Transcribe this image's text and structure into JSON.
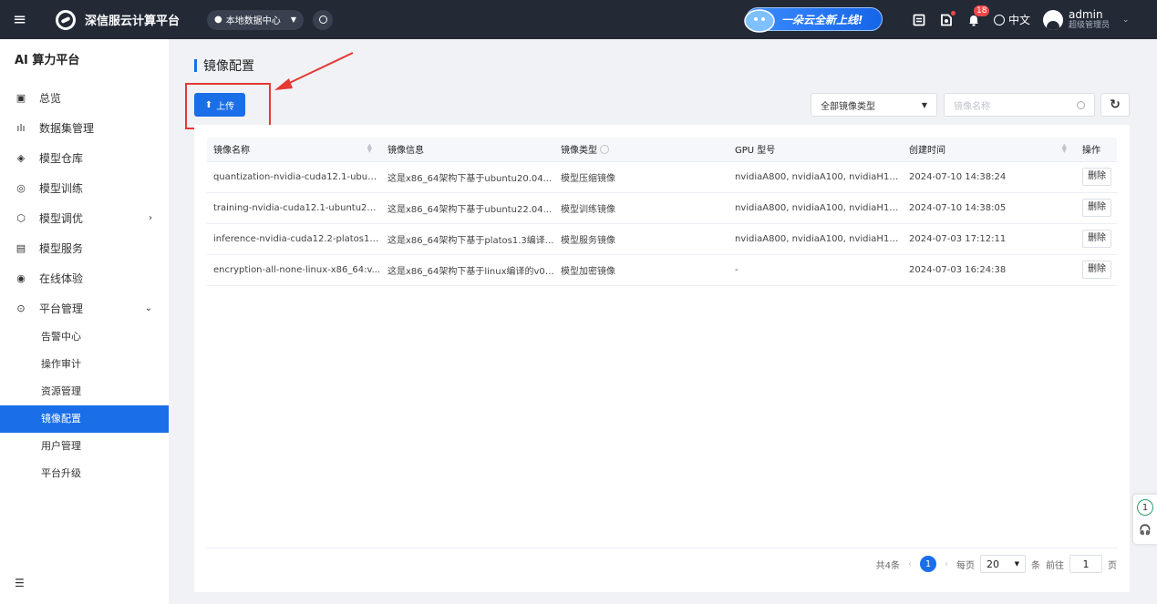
{
  "topbar": {
    "app_name": "深信服云计算平台",
    "datacenter": "本地数据中心",
    "promo_text": "一朵云全新上线!",
    "notification_count": "18",
    "language": "中文",
    "user_name": "admin",
    "user_role": "超级管理员"
  },
  "sidebar": {
    "title": "AI 算力平台",
    "items": [
      {
        "label": "总览",
        "icon": "monitor-icon"
      },
      {
        "label": "数据集管理",
        "icon": "bar-chart-icon"
      },
      {
        "label": "模型仓库",
        "icon": "model-repo-icon"
      },
      {
        "label": "模型训练",
        "icon": "training-icon"
      },
      {
        "label": "模型调优",
        "icon": "tuning-icon"
      },
      {
        "label": "模型服务",
        "icon": "service-icon"
      },
      {
        "label": "在线体验",
        "icon": "chat-icon"
      },
      {
        "label": "平台管理",
        "icon": "settings-icon"
      }
    ],
    "sub_items": [
      "告警中心",
      "操作审计",
      "资源管理",
      "镜像配置",
      "用户管理",
      "平台升级"
    ],
    "active_sub": "镜像配置"
  },
  "page": {
    "title": "镜像配置",
    "upload_label": "上传",
    "type_filter": "全部镜像类型",
    "search_placeholder": "镜像名称"
  },
  "table": {
    "columns": [
      "镜像名称",
      "镜像信息",
      "镜像类型",
      "GPU 型号",
      "创建时间",
      "操作"
    ],
    "rows": [
      {
        "name": "quantization-nvidia-cuda12.1-ubun...",
        "info": "这是x86_64架构下基于ubuntu20.04...",
        "type": "模型压缩镜像",
        "gpu": "nvidiaA800, nvidiaA100, nvidiaH10...",
        "created": "2024-07-10 14:38:24",
        "action": "删除"
      },
      {
        "name": "training-nvidia-cuda12.1-ubuntu22....",
        "info": "这是x86_64架构下基于ubuntu22.04...",
        "type": "模型训练镜像",
        "gpu": "nvidiaA800, nvidiaA100, nvidiaH10...",
        "created": "2024-07-10 14:38:05",
        "action": "删除"
      },
      {
        "name": "inference-nvidia-cuda12.2-platos1....",
        "info": "这是x86_64架构下基于platos1.3编译...",
        "type": "模型服务镜像",
        "gpu": "nvidiaA800, nvidiaA100, nvidiaH10...",
        "created": "2024-07-03 17:12:11",
        "action": "删除"
      },
      {
        "name": "encryption-all-none-linux-x86_64:v...",
        "info": "这是x86_64架构下基于linux编译的v0....",
        "type": "模型加密镜像",
        "gpu": "-",
        "created": "2024-07-03 16:24:38",
        "action": "删除"
      }
    ]
  },
  "pagination": {
    "total": "共4条",
    "current_page": "1",
    "per_page_label": "每页",
    "page_size": "20",
    "unit": "条",
    "goto_label": "前往",
    "goto_value": "1",
    "page_suffix": "页"
  },
  "float_widget": {
    "count": "1"
  },
  "colors": {
    "topbar_bg": "#232a36",
    "accent": "#1a6fe8",
    "highlight_red": "#e53935",
    "badge_red": "#f04848"
  }
}
